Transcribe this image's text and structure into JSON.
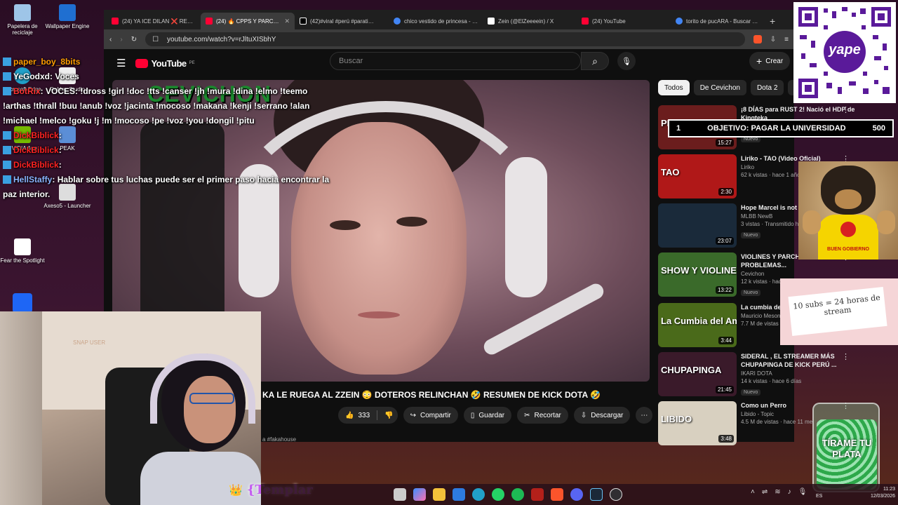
{
  "desktop": {
    "icons": [
      {
        "label": "Papelera de reciclaje",
        "icon": "recycle-bin-icon"
      },
      {
        "label": "Wallpaper Engine",
        "icon": "wallpaper-engine-icon"
      },
      {
        "label": "Microsoft Edge",
        "icon": "edge-icon"
      },
      {
        "label": "Roblox Studio",
        "icon": "roblox-studio-icon"
      },
      {
        "label": "NVIDIA App",
        "icon": "nvidia-icon"
      },
      {
        "label": "PEAK",
        "icon": "peak-icon"
      },
      {
        "label": "Axeso5 - Launcher",
        "icon": "axeso5-icon"
      },
      {
        "label": "Fear the Spotlight",
        "icon": "file-icon"
      }
    ]
  },
  "browser": {
    "tabs": [
      {
        "label": "(24) YA ICE DILAN ❌ REY T…",
        "color": "#ff0033"
      },
      {
        "label": "(24) 🔥 CPPS Y PARCHA…",
        "color": "#ff0033",
        "active": true
      },
      {
        "label": "(42)#viral #perú #parati…",
        "color": "#ffffff"
      },
      {
        "label": "chico vestido de princesa - B…",
        "color": "#4285f4"
      },
      {
        "label": "Zein (@ElZeeeein) / X",
        "color": "#ffffff"
      },
      {
        "label": "(24) YouTube",
        "color": "#ff0033"
      },
      {
        "label": "torito de pucARA - Buscar co…",
        "color": "#4285f4"
      }
    ],
    "url": "youtube.com/watch?v=rJltuXISbhY"
  },
  "youtube": {
    "logo": "YouTube",
    "country": "PE",
    "search_placeholder": "Buscar",
    "create_label": "Crear",
    "channel_banner": "CEVICHON",
    "video_title": "KA LE RUEGA AL ZZEIN 😳 DOTEROS RELINCHAN 🤣 RESUMEN DE KICK DOTA 🤣",
    "likes": "333",
    "share_label": "Compartir",
    "save_label": "Guardar",
    "clip_label": "Recortar",
    "download_label": "Descargar",
    "desc_hint": "a #fakahouse",
    "chips": [
      "Todos",
      "De Cevichon",
      "Dota 2",
      "Vide"
    ],
    "recs": [
      {
        "title": "¡8 DÍAS para RUST 2! Nació el HDP de Kingteka",
        "channel": "",
        "meta": "34 k vistas · hace 21 horas",
        "badge": "Nuevo",
        "duration": "15:27",
        "thumb": "#6b1d1d",
        "overlay": "PERUST 2"
      },
      {
        "title": "Liriko - TAO (Video Oficial)",
        "channel": "Liriko",
        "meta": "62 k vistas · hace 1 año",
        "badge": "",
        "duration": "2:30",
        "thumb": "#b01818",
        "overlay": "TAO"
      },
      {
        "title": "Hope Marcel is not l",
        "channel": "MLBB NewB",
        "meta": "3 vistas · Transmitido h",
        "badge": "Nuevo",
        "duration": "23:07",
        "thumb": "#1a2a3a",
        "overlay": ""
      },
      {
        "title": "VIOLINES Y PARCHA KINGTEKA EN PROBLEMAS...",
        "channel": "Cevichon",
        "meta": "12 k vistas · hace",
        "badge": "Nuevo",
        "duration": "13:22",
        "thumb": "#3a6a2a",
        "overlay": "SHOW Y VIOLINES"
      },
      {
        "title": "La cumbia del Mesones ( La",
        "channel": "Mauricio Meson",
        "meta": "7.7 M de vistas",
        "badge": "",
        "duration": "3:44",
        "thumb": "#4a6a1a",
        "overlay": "La Cumbia del Amor"
      },
      {
        "title": "SIDERAL , EL STREAMER MÁS CHUPAPINGA DE KICK PERÚ ...",
        "channel": "IKARI DOTA",
        "meta": "14 k vistas · hace 6 días",
        "badge": "Nuevo",
        "duration": "21:45",
        "thumb": "#3a1a2a",
        "overlay": "CHUPAPINGA"
      },
      {
        "title": "Como un Perro",
        "channel": "Libido - Topic",
        "meta": "4.5 M de vistas · hace 11 me",
        "badge": "",
        "duration": "3:48",
        "thumb": "#d8d0c0",
        "overlay": "LIBIDO"
      }
    ]
  },
  "chat": [
    {
      "user": "paper_boy_8bits",
      "user_color": "#ff9d00",
      "text": ""
    },
    {
      "user": "YeGodxd",
      "user_color": "#ffffff",
      "text": ": Voces"
    },
    {
      "user": "BotRix",
      "user_color": "#ff3333",
      "text": ": VOCES: !dross !girl !doc !tts !canser !jh !mura !dina !elmo !teemo"
    },
    {
      "user": "",
      "user_color": "#ffffff",
      "text": "!arthas !thrall !buu !anub !voz !jacinta !mocoso !makana !kenji !serrano !alan"
    },
    {
      "user": "",
      "user_color": "#ffffff",
      "text": "!michael !melco !goku !j !m !mocoso !pe !voz !you !dongil !pitu"
    },
    {
      "user": "DickBiblick",
      "user_color": "#ff2222",
      "text": ":"
    },
    {
      "user": "DickBiblick",
      "user_color": "#ff2222",
      "text": ":"
    },
    {
      "user": "DickBiblick",
      "user_color": "#ff2222",
      "text": ":"
    },
    {
      "user": "HellStaffy",
      "user_color": "#8ab4ff",
      "text": ": Hablar sobre tus luchas puede ser el primer paso hacia encontrar la"
    },
    {
      "user": "",
      "user_color": "#ffffff",
      "text": "paz interior."
    }
  ],
  "overlays": {
    "goal_rank": "1",
    "goal_text": "OBJETIVO: PAGAR LA UNIVERSIDAD",
    "goal_value": "500",
    "qr_brand": "yape",
    "dog_shirt": "BUEN GOBIERNO",
    "note_text": "10 subs = 24 horas de stream",
    "jar_text": "TÍRAME TU PLATA",
    "webcam_watermark": "SNAP USER",
    "streamer_name": "{Templar"
  },
  "taskbar": {
    "lang": "ES",
    "time": "11:23",
    "date": "12/03/2026"
  }
}
